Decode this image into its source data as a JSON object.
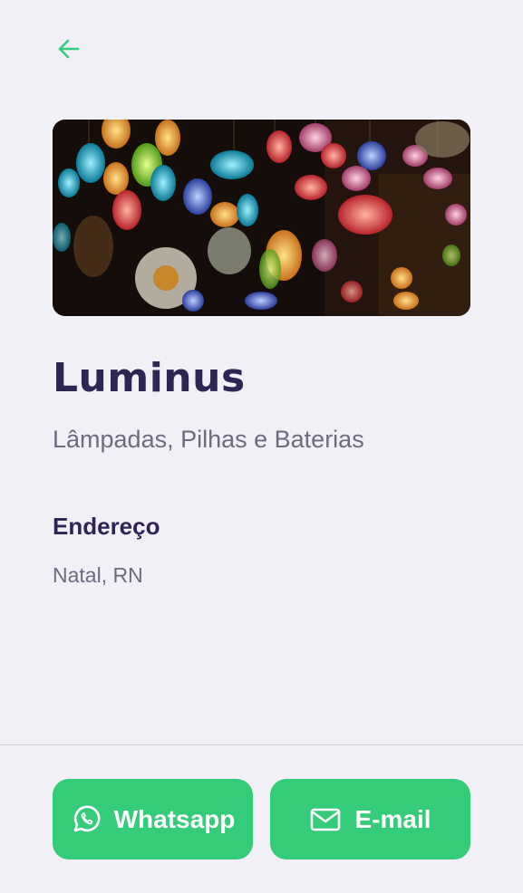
{
  "header": {
    "back_icon": "arrow-left-icon",
    "accent": "#34cb79"
  },
  "point": {
    "image_icon": "lanterns-photo",
    "name": "Luminus",
    "items": "Lâmpadas, Pilhas e Baterias"
  },
  "address": {
    "heading": "Endereço",
    "value": "Natal, RN"
  },
  "footer": {
    "whatsapp_label": "Whatsapp",
    "whatsapp_icon": "whatsapp-icon",
    "email_label": "E-mail",
    "email_icon": "mail-icon",
    "button_color": "#34cb79"
  },
  "colors": {
    "title": "#2f2555",
    "text": "#6c6c80",
    "background": "#f0f0f6"
  }
}
